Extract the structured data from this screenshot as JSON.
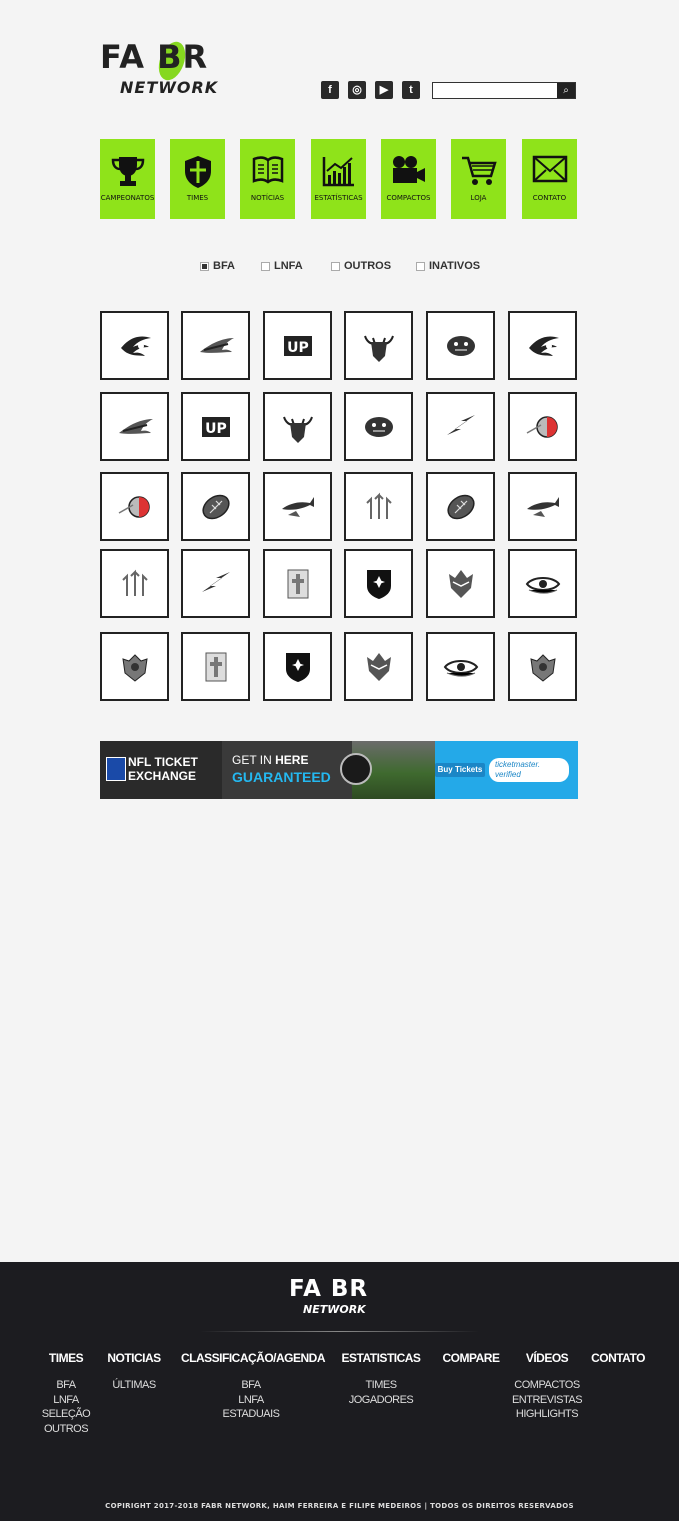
{
  "header": {
    "logo_top": "FA BR",
    "logo_bottom": "NETWORK",
    "social": [
      {
        "icon": "facebook-icon",
        "glyph": "f"
      },
      {
        "icon": "instagram-icon",
        "glyph": "◎"
      },
      {
        "icon": "youtube-icon",
        "glyph": "▶"
      },
      {
        "icon": "twitter-icon",
        "glyph": "t"
      }
    ],
    "search": {
      "placeholder": "",
      "button_icon": "search-icon",
      "button_glyph": "⌕"
    }
  },
  "nav": [
    {
      "label": "CAMPEONATOS",
      "icon": "trophy-icon"
    },
    {
      "label": "TIMES",
      "icon": "shield-icon"
    },
    {
      "label": "NOTÍCIAS",
      "icon": "book-icon"
    },
    {
      "label": "ESTATÍSTICAS",
      "icon": "chart-icon"
    },
    {
      "label": "COMPACTOS",
      "icon": "video-camera-icon"
    },
    {
      "label": "LOJA",
      "icon": "cart-icon"
    },
    {
      "label": "CONTATO",
      "icon": "envelope-icon"
    }
  ],
  "filters": [
    {
      "label": "BFA",
      "checked": true
    },
    {
      "label": "LNFA",
      "checked": false
    },
    {
      "label": "OUTROS",
      "checked": false
    },
    {
      "label": "INATIVOS",
      "checked": false
    }
  ],
  "teams": [
    [
      "claw-logo",
      "eagle-logo",
      "up-logo",
      "bull-logo",
      "panther-logo",
      "claw-logo"
    ],
    [
      "eagle-logo",
      "up-logo",
      "bull-logo",
      "panther-logo",
      "bolt-logo",
      "sphere-logo"
    ],
    [
      "sphere-logo",
      "football-logo",
      "shark-logo",
      "arrows-logo",
      "football-logo",
      "shark-logo"
    ],
    [
      "arrows-logo",
      "bolt-logo",
      "cross-logo",
      "maltese-shield-logo",
      "wolf-logo",
      "eye-logo"
    ],
    [
      "crest-logo",
      "cross-logo",
      "maltese-shield-logo",
      "wolf-logo",
      "eye-logo",
      "crest-logo"
    ]
  ],
  "banner": {
    "line1": "NFL TICKET",
    "line2": "EXCHANGE",
    "get_in": "GET IN",
    "here": "HERE",
    "guaranteed": "GUARANTEED",
    "buy": "Buy Tickets",
    "tm1": "ticketmaster.",
    "tm2": "verified"
  },
  "footer": {
    "logo_top": "FA BR",
    "logo_bottom": "NETWORK",
    "columns": [
      {
        "heading": "TIMES",
        "items": [
          "BFA",
          "LNFA",
          "SELEÇÃO",
          "OUTROS"
        ]
      },
      {
        "heading": "NOTICIAS",
        "items": [
          "ÚLTIMAS"
        ]
      },
      {
        "heading": "CLASSIFICAÇÃO/AGENDA",
        "items": [
          "BFA",
          "LNFA",
          "ESTADUAIS"
        ]
      },
      {
        "heading": "ESTATISTICAS",
        "items": [
          "TIMES",
          "JOGADORES"
        ]
      },
      {
        "heading": "COMPARE",
        "items": []
      },
      {
        "heading": "VÍDEOS",
        "items": [
          "COMPACTOS",
          "ENTREVISTAS",
          "HIGHLIGHTS"
        ]
      },
      {
        "heading": "CONTATO",
        "items": []
      }
    ],
    "copyright": "COPIRIGHT 2017-2018 FABR NETWORK, HAIM FERREIRA E FILIPE MEDEIROS  |  TODOS OS DIREITOS RESERVADOS"
  }
}
